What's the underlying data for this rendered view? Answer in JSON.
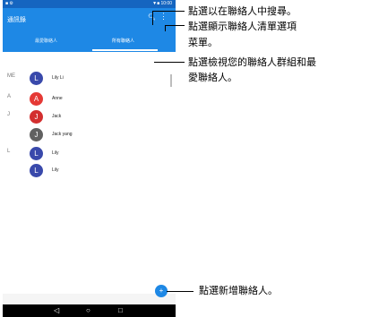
{
  "status_bar": {
    "left": "■ ⚙",
    "right": "▼■ 10:00"
  },
  "app_bar": {
    "title": "通訊錄",
    "search_icon": "search-icon",
    "menu_icon": "overflow-menu-icon"
  },
  "tabs": [
    {
      "label": "最愛聯絡人",
      "selected": false
    },
    {
      "label": "所有聯絡人",
      "selected": true
    }
  ],
  "contacts": [
    {
      "section": "ME",
      "initial": "L",
      "name": "Lily Li",
      "color": "#3949ab"
    },
    {
      "section": "A",
      "initial": "A",
      "name": "Anne",
      "color": "#e53935"
    },
    {
      "section": "J",
      "initial": "J",
      "name": "Jack",
      "color": "#d32f2f"
    },
    {
      "section": "",
      "initial": "J",
      "name": "Jack yang",
      "color": "#616161"
    },
    {
      "section": "L",
      "initial": "L",
      "name": "Lily",
      "color": "#3949ab"
    },
    {
      "section": "",
      "initial": "L",
      "name": "Lily",
      "color": "#3949ab"
    }
  ],
  "fab": {
    "icon": "add-contact-icon"
  },
  "nav_bar": {
    "back": "◁",
    "home": "○",
    "recents": "□"
  },
  "annotations": [
    {
      "text": "點選以在聯絡人中搜尋。"
    },
    {
      "text": "點選顯示聯絡人清單選項"
    },
    {
      "text": "菜單。"
    },
    {
      "text": "點選檢視您的聯絡人群組和最"
    },
    {
      "text": "愛聯絡人。"
    },
    {
      "text": "點選新增聯絡人。"
    }
  ]
}
